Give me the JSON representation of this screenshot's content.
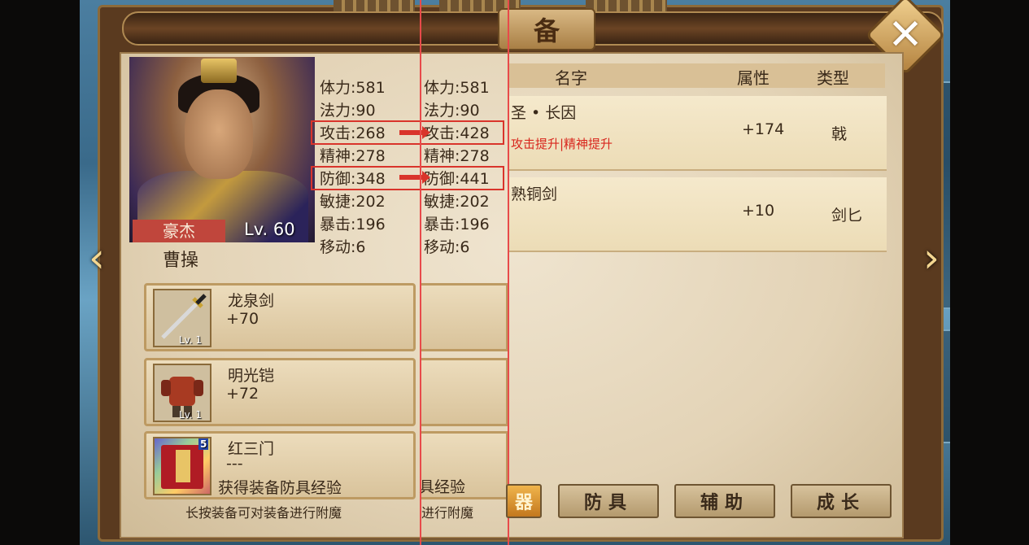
{
  "window": {
    "title": "备",
    "close_label": "✕"
  },
  "nav": {
    "prev_label": "‹",
    "next_label": "›"
  },
  "hero": {
    "class": "豪杰",
    "level": "Lv. 60",
    "name": "曹操"
  },
  "stats_current": [
    {
      "label": "体力",
      "value": "581"
    },
    {
      "label": "法力",
      "value": "90"
    },
    {
      "label": "攻击",
      "value": "268"
    },
    {
      "label": "精神",
      "value": "278"
    },
    {
      "label": "防御",
      "value": "348"
    },
    {
      "label": "敏捷",
      "value": "202"
    },
    {
      "label": "暴击",
      "value": "196"
    },
    {
      "label": "移动",
      "value": "6"
    }
  ],
  "stats_new": [
    {
      "label": "体力",
      "value": "581"
    },
    {
      "label": "法力",
      "value": "90"
    },
    {
      "label": "攻击",
      "value": "428"
    },
    {
      "label": "精神",
      "value": "278"
    },
    {
      "label": "防御",
      "value": "441"
    },
    {
      "label": "敏捷",
      "value": "202"
    },
    {
      "label": "暴击",
      "value": "196"
    },
    {
      "label": "移动",
      "value": "6"
    }
  ],
  "stat_separator": ":",
  "equipped": [
    {
      "name": "龙泉剑",
      "value": "+70",
      "level": "Lv. 1",
      "icon": "sword-icon"
    },
    {
      "name": "明光铠",
      "value": "+72",
      "level": "Lv. 1",
      "icon": "armor-icon"
    },
    {
      "name": "红三门",
      "value": "---",
      "level": "5",
      "icon": "book-icon",
      "note": "获得装备防具经验"
    }
  ],
  "ghost_note": "具经验",
  "tip": "长按装备可对装备进行附魔",
  "tip_ghost": "进行附魔",
  "table": {
    "headers": {
      "name": "名字",
      "attr": "属性",
      "type": "类型"
    },
    "rows": [
      {
        "name": "圣 • 长因",
        "effect": "攻击提升|精神提升",
        "attr": "+174",
        "type": "戟"
      },
      {
        "name": "熟铜剑",
        "effect": "",
        "attr": "+10",
        "type": "剑匕"
      }
    ]
  },
  "tabs": {
    "active": "器",
    "armor": "防具",
    "assist": "辅助",
    "growth": "成长"
  },
  "colors": {
    "highlight": "#d9342b",
    "effect_text": "#d8271e",
    "active_tab": "#f0b44c"
  }
}
